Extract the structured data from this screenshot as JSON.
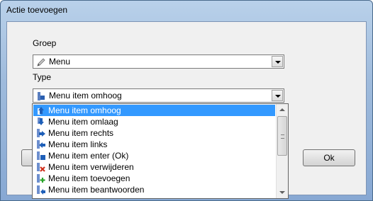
{
  "window": {
    "title": "Actie toevoegen"
  },
  "labels": {
    "group": "Groep",
    "type": "Type"
  },
  "group_combo": {
    "value": "Menu",
    "icon": "pencil-icon"
  },
  "type_combo": {
    "value": "Menu item omhoog",
    "icon": "menu-item-icon"
  },
  "list": {
    "items": [
      {
        "label": "Menu item omhoog",
        "icon": "menu-item-up-icon"
      },
      {
        "label": "Menu item omlaag",
        "icon": "menu-item-down-icon"
      },
      {
        "label": "Menu item rechts",
        "icon": "menu-item-right-icon"
      },
      {
        "label": "Menu item links",
        "icon": "menu-item-left-icon"
      },
      {
        "label": "Menu item enter (Ok)",
        "icon": "menu-item-enter-icon"
      },
      {
        "label": "Menu item verwijderen",
        "icon": "menu-item-delete-icon"
      },
      {
        "label": "Menu item toevoegen",
        "icon": "menu-item-add-icon"
      },
      {
        "label": "Menu item beantwoorden",
        "icon": "menu-item-reply-icon"
      }
    ],
    "selected_index": 0
  },
  "buttons": {
    "ok": "Ok"
  },
  "colors": {
    "selection": "#3399ff",
    "title_bar": "#b9d1ea"
  }
}
